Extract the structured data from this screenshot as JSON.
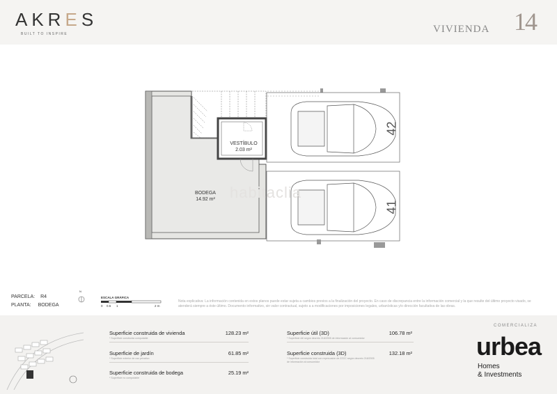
{
  "header": {
    "logo_left": "AKR",
    "logo_e": "E",
    "logo_right": "S",
    "tagline": "BUILT TO INSPIRE",
    "vivienda_label": "VIVIENDA",
    "vivienda_number": "14"
  },
  "plan": {
    "rooms": [
      {
        "name": "BODEGA",
        "area": "14.92 m²"
      },
      {
        "name": "VESTÍBULO",
        "area": "2.03 m²"
      }
    ],
    "parking_numbers": [
      "42",
      "41"
    ],
    "watermark": "habitaclia"
  },
  "meta": {
    "parcela_label": "PARCELA:",
    "parcela_value": "R4",
    "planta_label": "PLANTA:",
    "planta_value": "BODEGA",
    "scale_title": "ESCALA GRÁFICA",
    "scale_ticks": [
      "0",
      "0.5",
      "1",
      "2 m"
    ],
    "compass": "N"
  },
  "note": "Nota explicativa: La información contenida en estos planos puede estar sujeta a cambios previos a la finalización del proyecto. En caso de discrepancia entre la información comercial y la que resulte del último proyecto visado, se atenderá siempre a éste último. Documento informativo, sin valor contractual, sujeto a a modificaciones por imposiciones legales, urbanísticas y/o dirección facultativa de las obras.",
  "specs": [
    {
      "name": "Superficie construida de vivienda",
      "note": "* Superficie construida computable",
      "value": "128.23 m²"
    },
    {
      "name": "Superficie de jardín",
      "note": "* Superficie exterior de uso privativo",
      "value": "61.85 m²"
    },
    {
      "name": "Superficie construida de bodega",
      "note": "* Superficie no computable",
      "value": "25.19 m²"
    },
    {
      "name": "Superficie útil (3D)",
      "note": "* Superficie útil según decreto 218/2005 de información al consumidor",
      "value": "106.78 m²"
    },
    {
      "name": "Superficie construida (3D)",
      "note": "* Superficie construida total con repercusión de ZZCC según decreto 218/2005 de información al consumidor",
      "value": "132.18 m²"
    }
  ],
  "brand": {
    "comercializa": "COMERCIALIZA",
    "name": "urbea",
    "sub1": "Homes",
    "sub2": "& Investments"
  }
}
